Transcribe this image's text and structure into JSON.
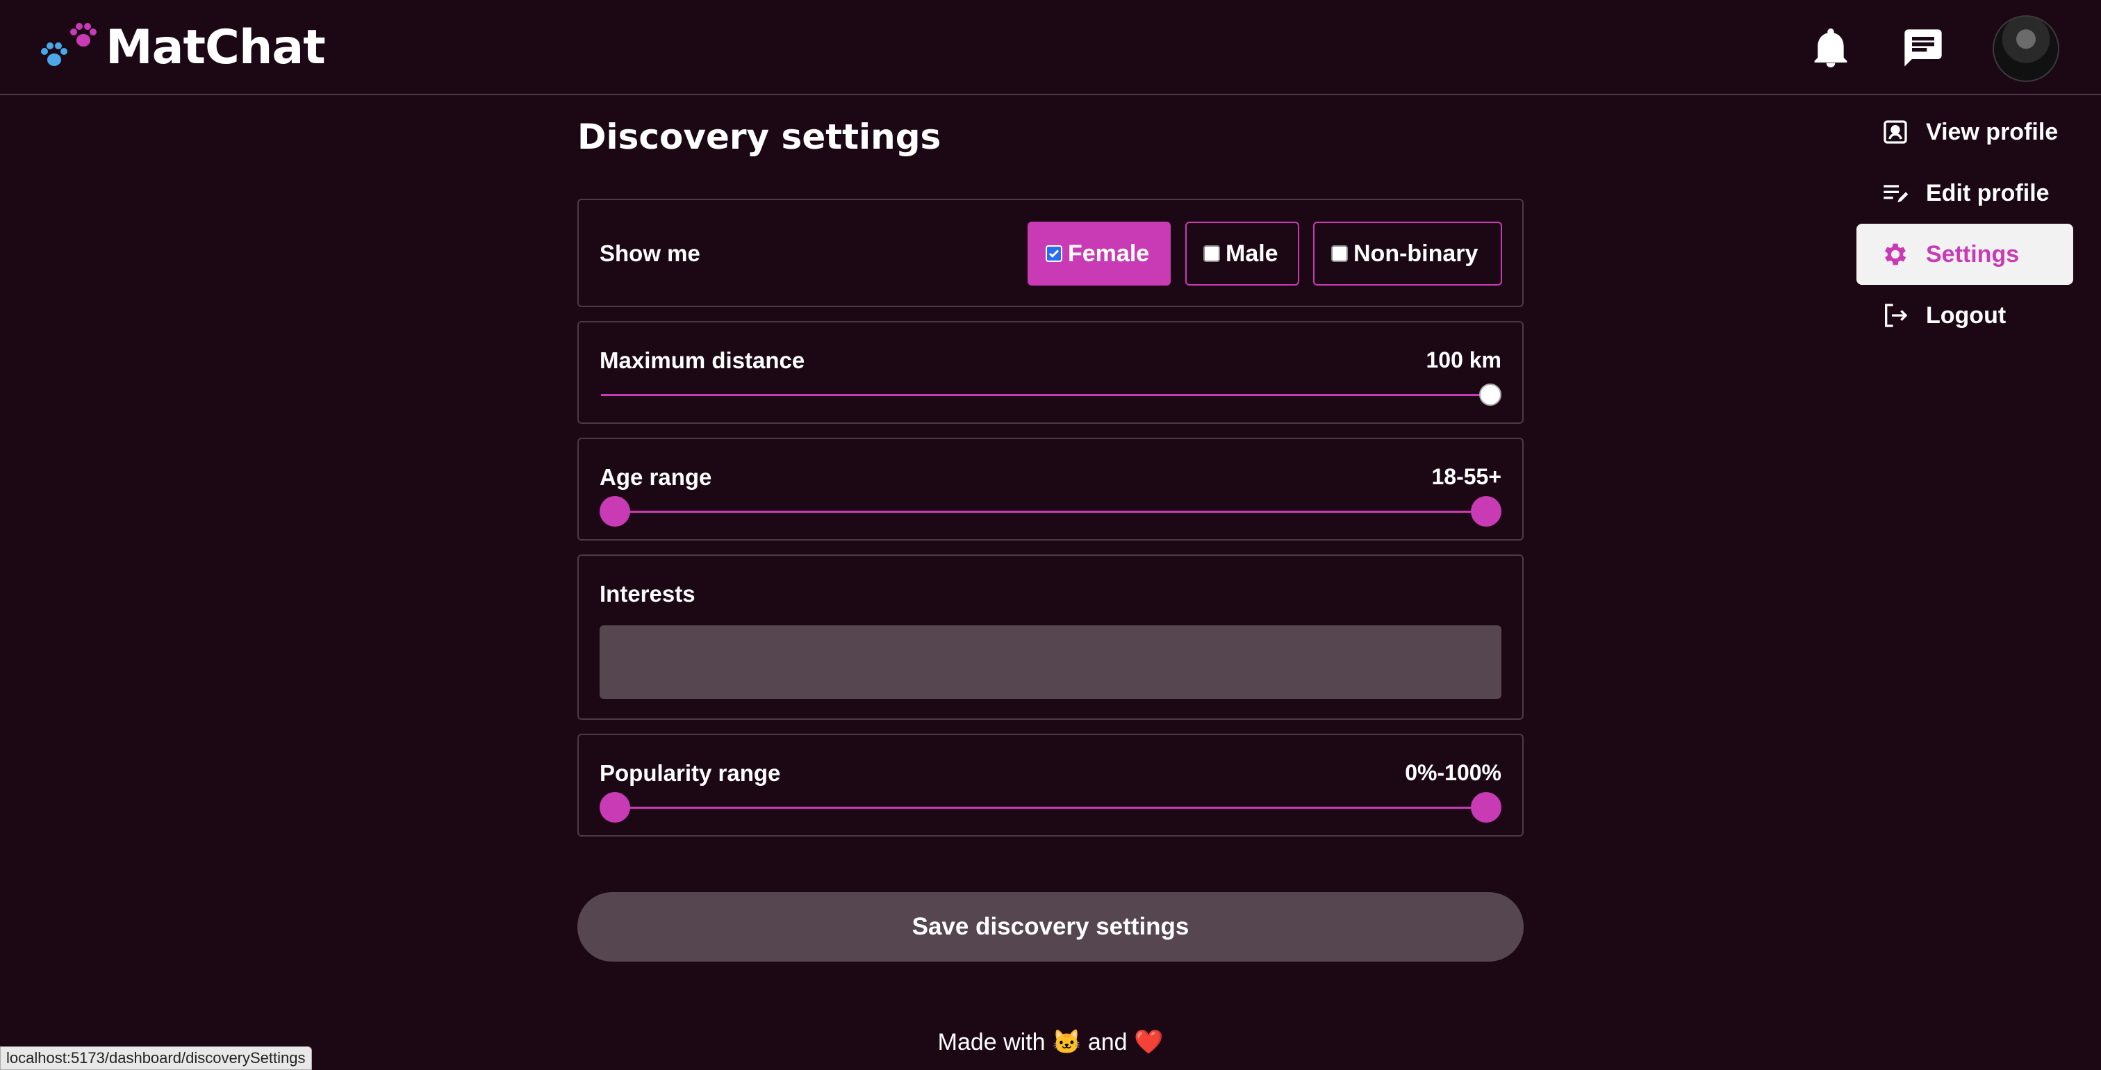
{
  "app": {
    "name": "MatChat"
  },
  "header": {
    "notifications_icon": "bell-icon",
    "messages_icon": "chat-icon",
    "avatar_icon": "user-avatar"
  },
  "menu": {
    "items": [
      {
        "label": "View profile",
        "icon": "profile-card-icon",
        "active": false
      },
      {
        "label": "Edit profile",
        "icon": "edit-list-icon",
        "active": false
      },
      {
        "label": "Settings",
        "icon": "gear-icon",
        "active": true
      },
      {
        "label": "Logout",
        "icon": "logout-icon",
        "active": false
      }
    ]
  },
  "page": {
    "title": "Discovery settings"
  },
  "show_me": {
    "label": "Show me",
    "options": [
      {
        "label": "Female",
        "checked": true
      },
      {
        "label": "Male",
        "checked": false
      },
      {
        "label": "Non-binary",
        "checked": false
      }
    ]
  },
  "distance": {
    "label": "Maximum distance",
    "value_text": "100 km",
    "value": 100,
    "max": 100
  },
  "age": {
    "label": "Age range",
    "value_text": "18-55+",
    "min": 18,
    "max": 55
  },
  "interests": {
    "label": "Interests",
    "placeholder": ""
  },
  "popularity": {
    "label": "Popularity range",
    "value_text": "0%-100%",
    "min": 0,
    "max": 100
  },
  "save_button": {
    "label": "Save discovery settings"
  },
  "footer": {
    "text_before": "Made with",
    "emoji_1": "🐱",
    "text_middle": "and",
    "emoji_2": "❤️"
  },
  "status_url": "localhost:5173/dashboard/discoverySettings",
  "colors": {
    "accent": "#c93ab5",
    "background": "#1c0815",
    "border": "#4b3a45",
    "muted": "#564650",
    "paw_blue": "#4aa8e8"
  }
}
